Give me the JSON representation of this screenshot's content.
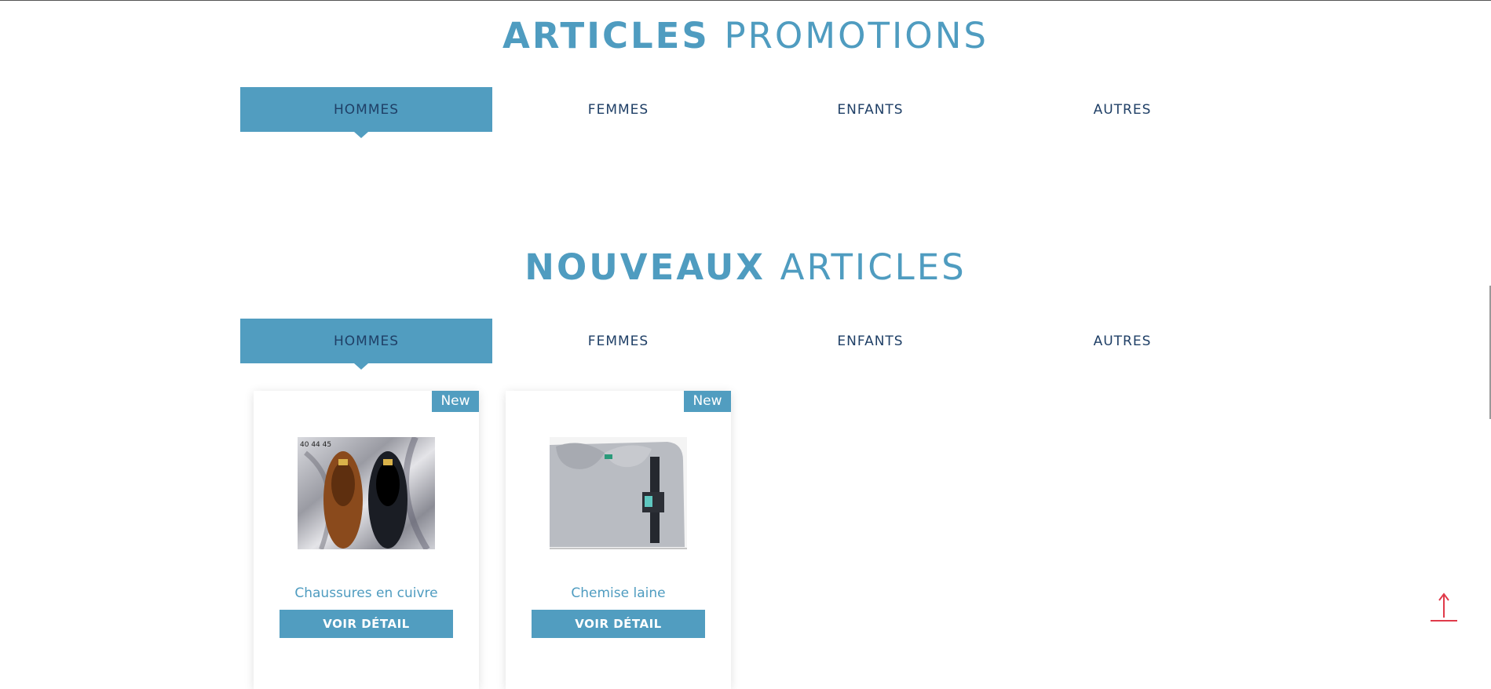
{
  "promotions": {
    "title_strong": "ARTICLES",
    "title_light": "PROMOTIONS",
    "tabs": [
      "HOMMES",
      "FEMMES",
      "ENFANTS",
      "AUTRES"
    ],
    "active_tab": "HOMMES"
  },
  "new_articles": {
    "title_strong": "NOUVEAUX",
    "title_light": "ARTICLES",
    "tabs": [
      "HOMMES",
      "FEMMES",
      "ENFANTS",
      "AUTRES"
    ],
    "active_tab": "HOMMES",
    "products": [
      {
        "badge": "New",
        "name": "Chaussures en cuivre",
        "button": "VOIR DÉTAIL",
        "image": "shoes-image",
        "image_text": "40 44 45"
      },
      {
        "badge": "New",
        "name": "Chemise laine",
        "button": "VOIR DÉTAIL",
        "image": "shirt-image"
      }
    ]
  },
  "scroll_top_icon": "arrow-up-icon",
  "colors": {
    "accent": "#519dc0",
    "tab_text": "#1f3f66",
    "scroll_top": "#e03a4a"
  }
}
